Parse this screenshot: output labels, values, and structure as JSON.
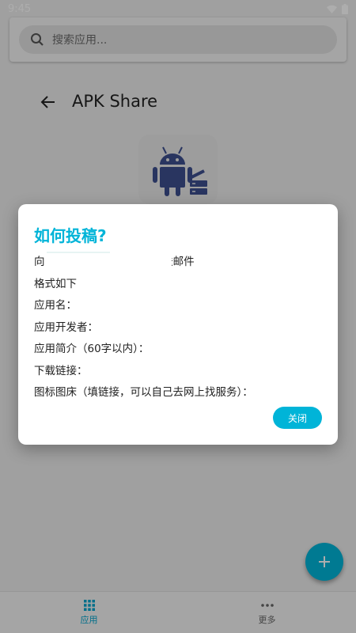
{
  "status_bar": {
    "time": "9:45"
  },
  "search": {
    "placeholder": "搜索应用..."
  },
  "header": {
    "title": "APK Share"
  },
  "dialog": {
    "title": "如何投稿?",
    "lines": [
      "向",
      "送邮件",
      "格式如下",
      "应用名：",
      "应用开发者：",
      "应用简介（60字以内）：",
      "下载链接：",
      "图标图床（填链接，可以自己去网上找服务）："
    ],
    "close_label": "关闭"
  },
  "bottom_nav": {
    "apps_label": "应用",
    "more_label": "更多"
  },
  "colors": {
    "accent": "#00b4d8",
    "android_icon": "#3d4f8e"
  }
}
